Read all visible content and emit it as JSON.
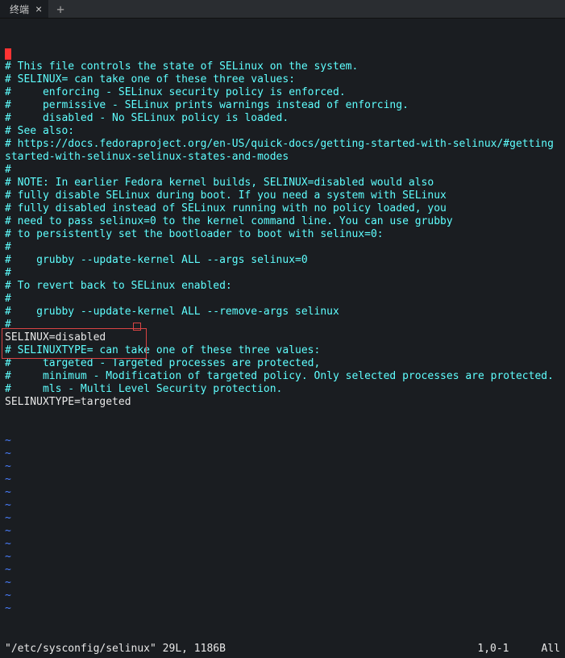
{
  "tab": {
    "label": "终端",
    "close_glyph": "×",
    "new_glyph": "+"
  },
  "lines": [
    {
      "cls": "comment",
      "cursor": true,
      "text": ""
    },
    {
      "cls": "comment",
      "text": "# This file controls the state of SELinux on the system."
    },
    {
      "cls": "comment",
      "text": "# SELINUX= can take one of these three values:"
    },
    {
      "cls": "comment",
      "text": "#     enforcing - SELinux security policy is enforced."
    },
    {
      "cls": "comment",
      "text": "#     permissive - SELinux prints warnings instead of enforcing."
    },
    {
      "cls": "comment",
      "text": "#     disabled - No SELinux policy is loaded."
    },
    {
      "cls": "comment",
      "text": "# See also:"
    },
    {
      "cls": "comment",
      "text": "# https://docs.fedoraproject.org/en-US/quick-docs/getting-started-with-selinux/#getting"
    },
    {
      "cls": "comment",
      "text": "started-with-selinux-selinux-states-and-modes"
    },
    {
      "cls": "comment",
      "text": "#"
    },
    {
      "cls": "comment",
      "text": "# NOTE: In earlier Fedora kernel builds, SELINUX=disabled would also"
    },
    {
      "cls": "comment",
      "text": "# fully disable SELinux during boot. If you need a system with SELinux"
    },
    {
      "cls": "comment",
      "text": "# fully disabled instead of SELinux running with no policy loaded, you"
    },
    {
      "cls": "comment",
      "text": "# need to pass selinux=0 to the kernel command line. You can use grubby"
    },
    {
      "cls": "comment",
      "text": "# to persistently set the bootloader to boot with selinux=0:"
    },
    {
      "cls": "comment",
      "text": "#"
    },
    {
      "cls": "comment",
      "text": "#    grubby --update-kernel ALL --args selinux=0"
    },
    {
      "cls": "comment",
      "text": "#"
    },
    {
      "cls": "comment",
      "text": "# To revert back to SELinux enabled:"
    },
    {
      "cls": "comment",
      "text": "#"
    },
    {
      "cls": "comment",
      "text": "#    grubby --update-kernel ALL --remove-args selinux"
    },
    {
      "cls": "comment",
      "text": "#"
    },
    {
      "cls": "plain",
      "text": "SELINUX=disabled"
    },
    {
      "cls": "comment",
      "text": "# SELINUXTYPE= can take one of these three values:"
    },
    {
      "cls": "comment",
      "text": "#     targeted - Targeted processes are protected,"
    },
    {
      "cls": "comment",
      "text": "#     minimum - Modification of targeted policy. Only selected processes are protected."
    },
    {
      "cls": "comment",
      "text": "#     mls - Multi Level Security protection."
    },
    {
      "cls": "plain",
      "text": "SELINUXTYPE=targeted"
    },
    {
      "cls": "plain",
      "text": ""
    },
    {
      "cls": "plain",
      "text": ""
    },
    {
      "cls": "tilde",
      "text": "~"
    },
    {
      "cls": "tilde",
      "text": "~"
    },
    {
      "cls": "tilde",
      "text": "~"
    },
    {
      "cls": "tilde",
      "text": "~"
    },
    {
      "cls": "tilde",
      "text": "~"
    },
    {
      "cls": "tilde",
      "text": "~"
    },
    {
      "cls": "tilde",
      "text": "~"
    },
    {
      "cls": "tilde",
      "text": "~"
    },
    {
      "cls": "tilde",
      "text": "~"
    },
    {
      "cls": "tilde",
      "text": "~"
    },
    {
      "cls": "tilde",
      "text": "~"
    },
    {
      "cls": "tilde",
      "text": "~"
    },
    {
      "cls": "tilde",
      "text": "~"
    },
    {
      "cls": "tilde",
      "text": "~"
    },
    {
      "cls": "plain",
      "text": ""
    },
    {
      "cls": "plain",
      "text": ""
    }
  ],
  "status": {
    "left": "\"/etc/sysconfig/selinux\" 29L, 1186B",
    "pos": "1,0-1",
    "scroll": "All"
  }
}
